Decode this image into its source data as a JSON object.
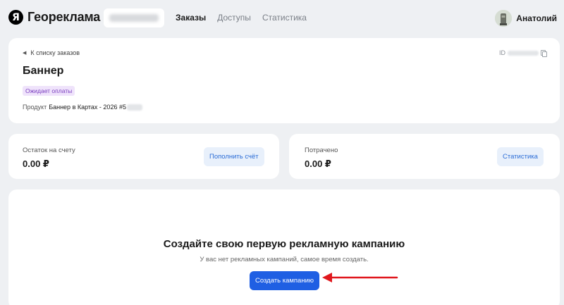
{
  "header": {
    "logo_mark": "Я",
    "logo_text": "Геореклама",
    "nav": [
      {
        "label": "Заказы",
        "active": true
      },
      {
        "label": "Доступы",
        "active": false
      },
      {
        "label": "Статистика",
        "active": false
      }
    ],
    "user_name": "Анатолий"
  },
  "order": {
    "back_label": "К списку заказов",
    "id_label": "ID",
    "title": "Баннер",
    "status": "Ожидает оплаты",
    "product_label": "Продукт",
    "product_value": "Баннер в Картах - 2026 #5"
  },
  "balance": {
    "label": "Остаток на счету",
    "value": "0.00 ₽",
    "button": "Пополнить счёт"
  },
  "spent": {
    "label": "Потрачено",
    "value": "0.00 ₽",
    "button": "Статистика"
  },
  "empty_state": {
    "title": "Создайте свою первую рекламную кампанию",
    "subtitle": "У вас нет рекламных кампаний, самое время создать.",
    "button": "Создать кампанию"
  },
  "colors": {
    "primary": "#1f5fe3",
    "status_badge_text": "#7b3fbf",
    "status_badge_bg": "#efe3fb",
    "annotation_arrow": "#e0171d"
  },
  "icons": [
    "yandex-logo-icon",
    "back-arrow-icon",
    "copy-icon",
    "avatar-icon",
    "red-arrow-annotation-icon"
  ]
}
